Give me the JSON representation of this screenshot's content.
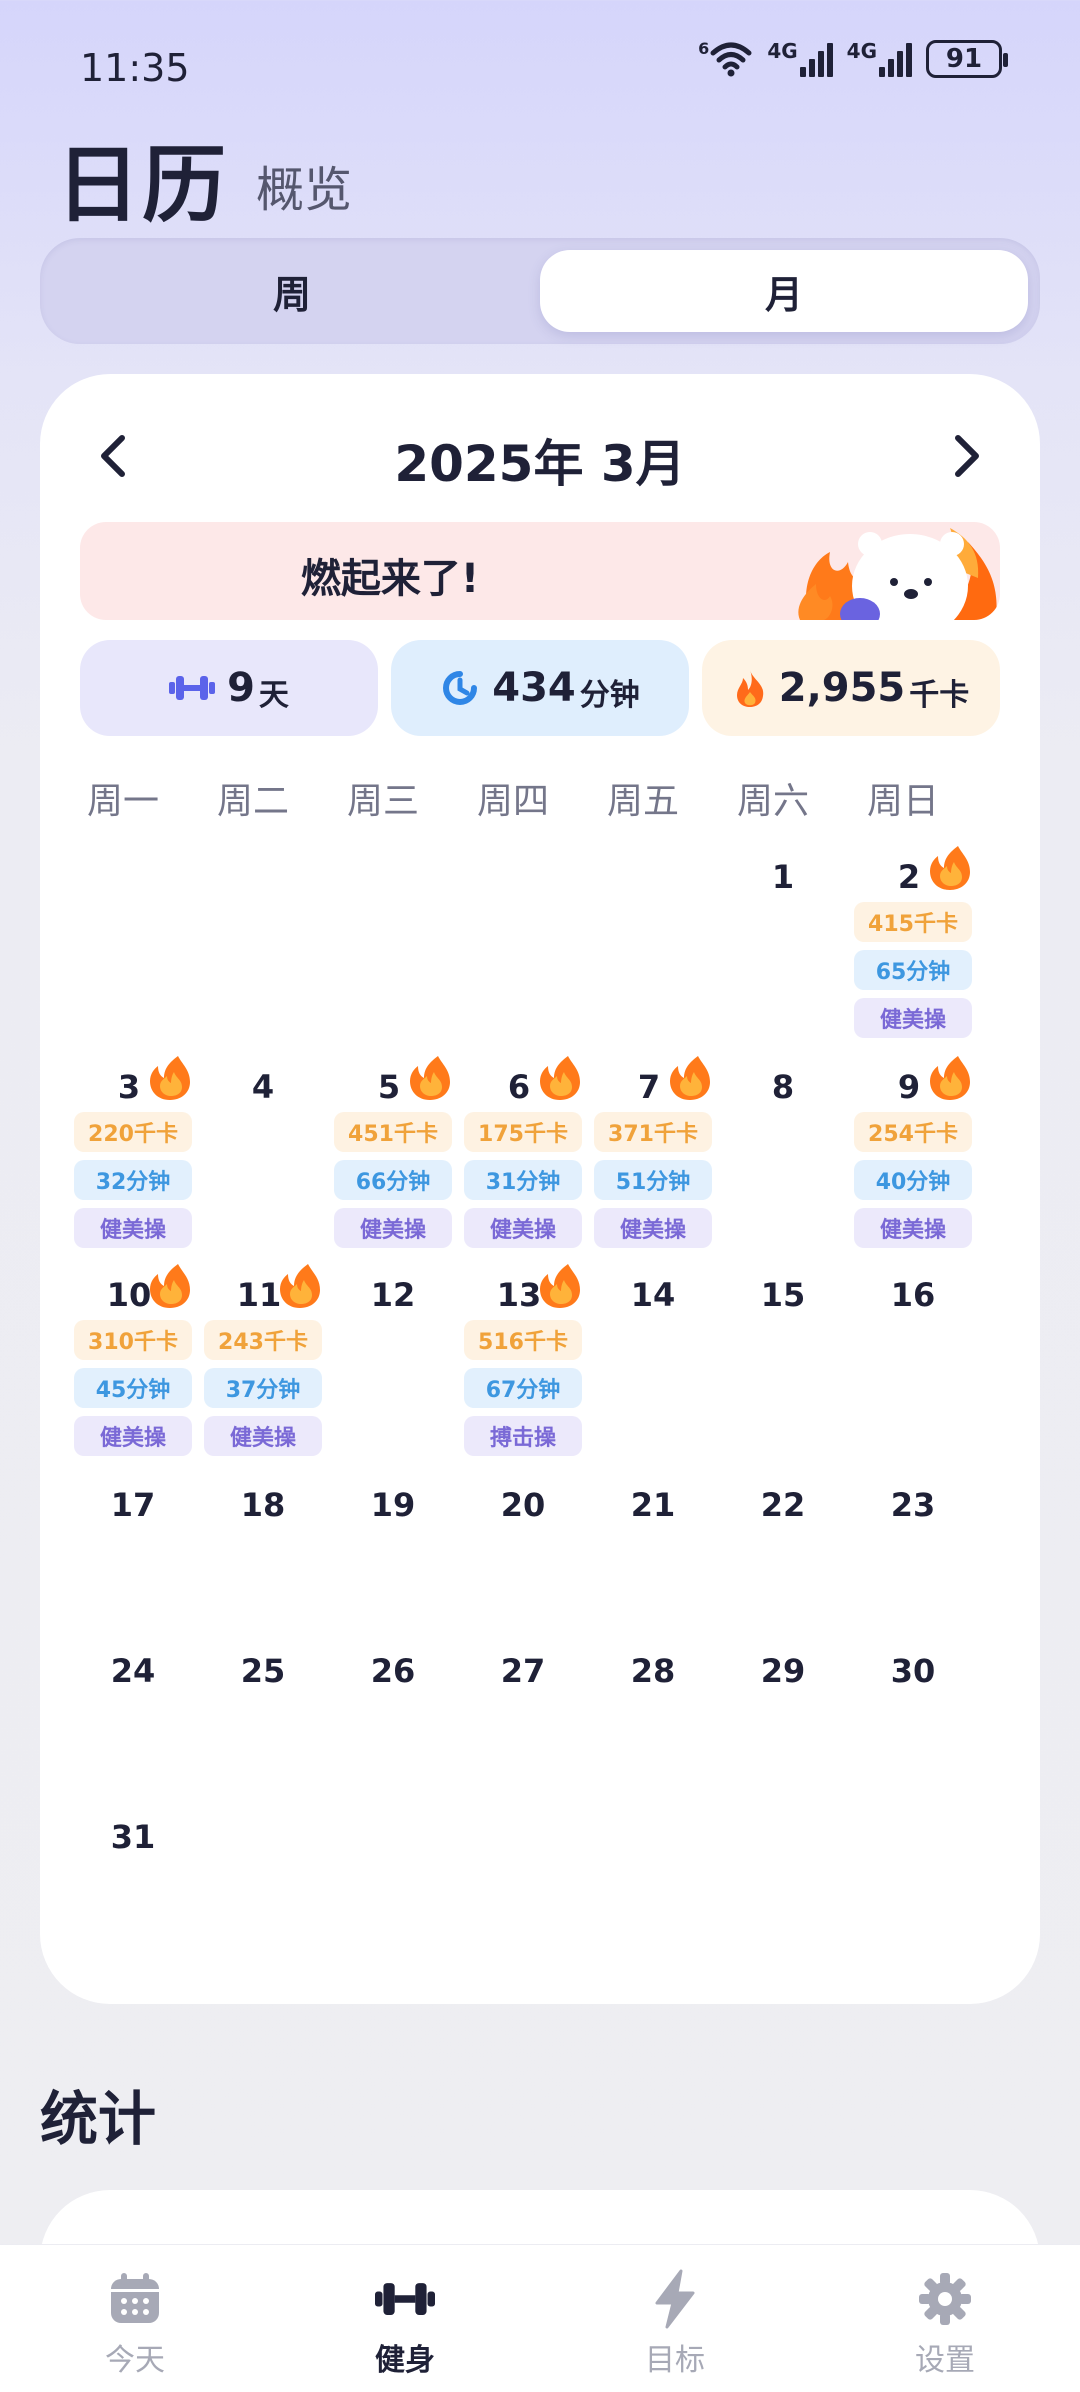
{
  "status": {
    "time": "11:35",
    "battery": "91",
    "net1": "4G",
    "net2": "4G",
    "wifi_tag": "6"
  },
  "header": {
    "title": "日历",
    "subtitle": "概览"
  },
  "segmented": {
    "week": "周",
    "month": "月",
    "selected": "month"
  },
  "calendar": {
    "month_title": "2025年 3月",
    "banner_text": "燃起来了!",
    "summary": {
      "days_value": "9",
      "days_unit": "天",
      "minutes_value": "434",
      "minutes_unit": "分钟",
      "kcal_value": "2,955",
      "kcal_unit": "千卡"
    },
    "weekdays": [
      "周一",
      "周二",
      "周三",
      "周四",
      "周五",
      "周六",
      "周日"
    ],
    "days": [
      {
        "day": "1"
      },
      {
        "day": "2",
        "kcal": "415千卡",
        "mins": "65分钟",
        "type": "健美操"
      },
      {
        "day": "3",
        "kcal": "220千卡",
        "mins": "32分钟",
        "type": "健美操"
      },
      {
        "day": "4"
      },
      {
        "day": "5",
        "kcal": "451千卡",
        "mins": "66分钟",
        "type": "健美操"
      },
      {
        "day": "6",
        "kcal": "175千卡",
        "mins": "31分钟",
        "type": "健美操"
      },
      {
        "day": "7",
        "kcal": "371千卡",
        "mins": "51分钟",
        "type": "健美操"
      },
      {
        "day": "8"
      },
      {
        "day": "9",
        "kcal": "254千卡",
        "mins": "40分钟",
        "type": "健美操"
      },
      {
        "day": "10",
        "kcal": "310千卡",
        "mins": "45分钟",
        "type": "健美操"
      },
      {
        "day": "11",
        "kcal": "243千卡",
        "mins": "37分钟",
        "type": "健美操"
      },
      {
        "day": "12"
      },
      {
        "day": "13",
        "kcal": "516千卡",
        "mins": "67分钟",
        "type": "搏击操"
      },
      {
        "day": "14"
      },
      {
        "day": "15"
      },
      {
        "day": "16"
      },
      {
        "day": "17"
      },
      {
        "day": "18"
      },
      {
        "day": "19"
      },
      {
        "day": "20"
      },
      {
        "day": "21"
      },
      {
        "day": "22"
      },
      {
        "day": "23"
      },
      {
        "day": "24"
      },
      {
        "day": "25"
      },
      {
        "day": "26"
      },
      {
        "day": "27"
      },
      {
        "day": "28"
      },
      {
        "day": "29"
      },
      {
        "day": "30"
      },
      {
        "day": "31"
      }
    ]
  },
  "stats": {
    "title": "统计"
  },
  "tabbar": {
    "items": [
      {
        "label": "今天",
        "icon": "calendar-icon"
      },
      {
        "label": "健身",
        "icon": "dumbbell-icon"
      },
      {
        "label": "目标",
        "icon": "lightning-icon"
      },
      {
        "label": "设置",
        "icon": "gear-icon"
      }
    ],
    "active": 1
  },
  "colors": {
    "accent_dark": "#1f2137",
    "kcal": "#f0a23a",
    "minutes": "#3d97e0",
    "type": "#7a69d6",
    "fire": "#ff7a1a"
  }
}
